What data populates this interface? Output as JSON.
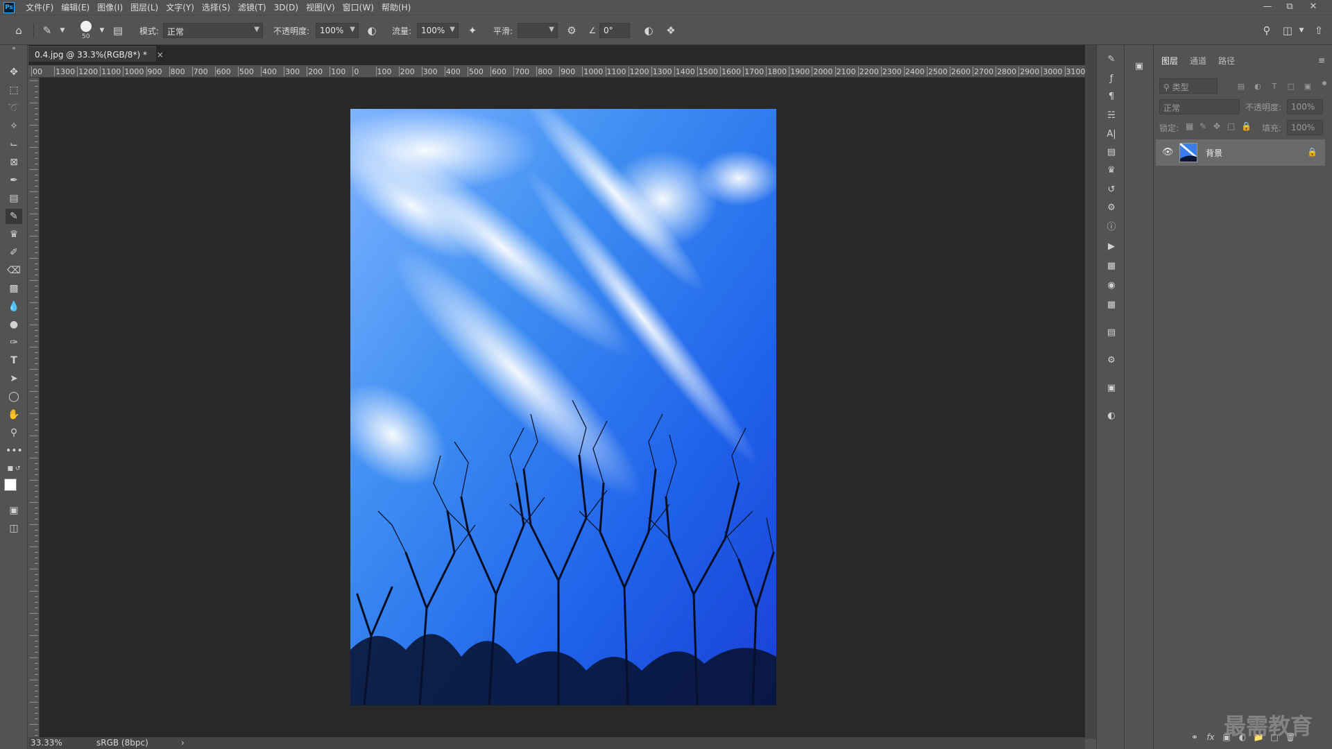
{
  "menubar": {
    "logo": "Ps",
    "items": [
      "文件(F)",
      "编辑(E)",
      "图像(I)",
      "图层(L)",
      "文字(Y)",
      "选择(S)",
      "滤镜(T)",
      "3D(D)",
      "视图(V)",
      "窗口(W)",
      "帮助(H)"
    ],
    "window_controls": [
      "minimize-icon",
      "restore-icon",
      "close-icon"
    ]
  },
  "options": {
    "brush_size": "50",
    "mode_label": "模式:",
    "mode_value": "正常",
    "opacity_label": "不透明度:",
    "opacity_value": "100%",
    "flow_label": "流量:",
    "flow_value": "100%",
    "smoothing_label": "平滑:",
    "smoothing_value": "",
    "angle_value": "0°"
  },
  "document": {
    "tab_title": "0.4.jpg @ 33.3%(RGB/8*) *",
    "ruler_h_labels": [
      "00",
      "1300",
      "1200",
      "1100",
      "1000",
      "900",
      "800",
      "700",
      "600",
      "500",
      "400",
      "300",
      "200",
      "100",
      "0",
      "100",
      "200",
      "300",
      "400",
      "500",
      "600",
      "700",
      "800",
      "900",
      "1000",
      "1100",
      "1200",
      "1300",
      "1400",
      "1500",
      "1600",
      "1700",
      "1800",
      "1900",
      "2000",
      "2100",
      "2200",
      "2300",
      "2400",
      "2500",
      "2600",
      "2700",
      "2800",
      "2900",
      "3000",
      "3100"
    ],
    "zoom": "33.33%",
    "color_profile": "sRGB (8bpc)"
  },
  "layers_panel": {
    "tabs": [
      "图层",
      "通道",
      "路径"
    ],
    "filter_placeholder": "类型",
    "blend_mode": "正常",
    "opacity_label": "不透明度:",
    "opacity_value": "100%",
    "lock_label": "锁定:",
    "fill_label": "填充:",
    "fill_value": "100%",
    "layers": [
      {
        "name": "背景",
        "visible": true,
        "locked": true
      }
    ]
  },
  "watermark": "最需教育",
  "colors": {
    "ui_bg": "#535353",
    "canvas_bg": "#282828",
    "sky_blue": "#1a55e0",
    "accent": "#31a8ff"
  }
}
